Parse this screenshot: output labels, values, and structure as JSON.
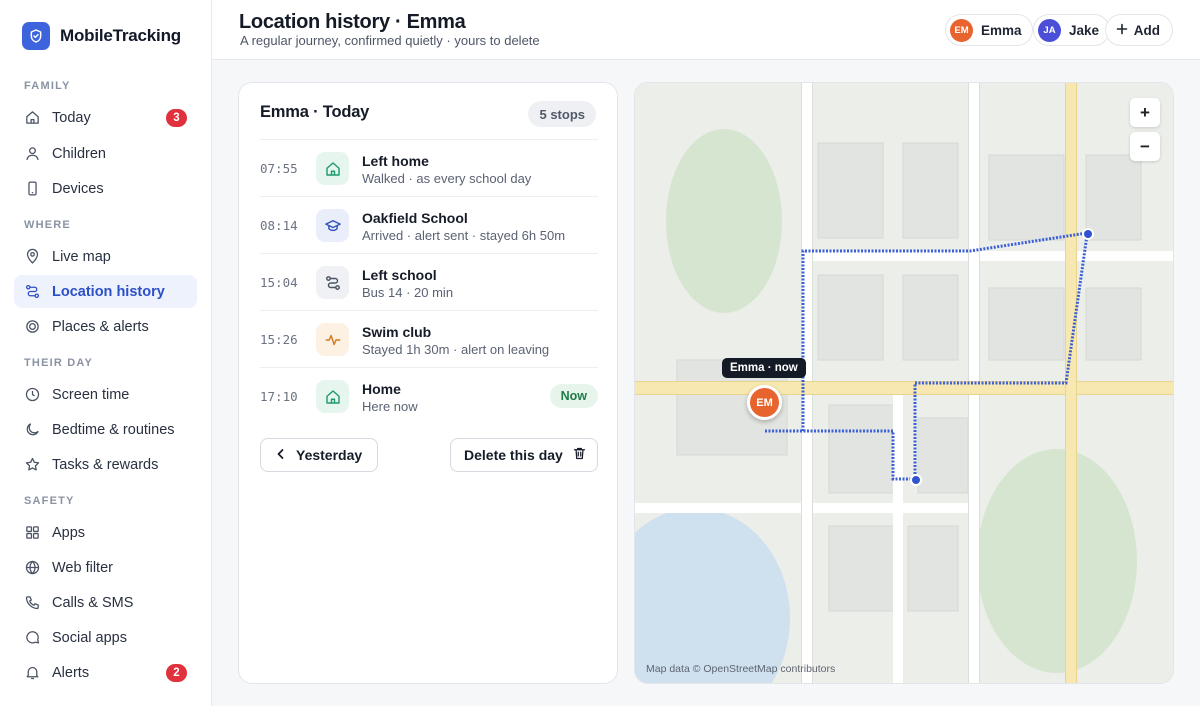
{
  "brand": {
    "name": "MobileTracking"
  },
  "nav": {
    "sections": [
      {
        "label": "FAMILY"
      },
      {
        "label": "WHERE"
      },
      {
        "label": "THEIR DAY"
      },
      {
        "label": "SAFETY"
      }
    ],
    "items": [
      {
        "label": "Today",
        "icon": "home-icon",
        "badge": "3"
      },
      {
        "label": "Children",
        "icon": "person-icon"
      },
      {
        "label": "Devices",
        "icon": "phone-icon"
      },
      {
        "label": "Live map",
        "icon": "pin-icon"
      },
      {
        "label": "Location history",
        "icon": "route-icon",
        "active": true
      },
      {
        "label": "Places & alerts",
        "icon": "target-icon"
      },
      {
        "label": "Screen time",
        "icon": "clock-icon"
      },
      {
        "label": "Bedtime & routines",
        "icon": "moon-icon"
      },
      {
        "label": "Tasks & rewards",
        "icon": "star-icon"
      },
      {
        "label": "Apps",
        "icon": "grid-icon"
      },
      {
        "label": "Web filter",
        "icon": "globe-icon"
      },
      {
        "label": "Calls & SMS",
        "icon": "phone-call-icon"
      },
      {
        "label": "Social apps",
        "icon": "chat-icon"
      },
      {
        "label": "Alerts",
        "icon": "bell-icon",
        "badge": "2"
      }
    ]
  },
  "header": {
    "title": "Location history · Emma",
    "subtitle": "A regular journey, confirmed quietly · yours to delete",
    "children": [
      {
        "initials": "EM",
        "name": "Emma",
        "color": "#e8642f"
      },
      {
        "initials": "JA",
        "name": "Jake",
        "color": "#4b4fd8"
      }
    ],
    "add_label": "Add"
  },
  "timeline": {
    "title": "Emma · Today",
    "stops_count": "5 stops",
    "stops": [
      {
        "time": "07:55",
        "title": "Left home",
        "detail": "Walked · as every school day",
        "icon": "home-icon",
        "tint": "#e7f5ef",
        "color": "#1f9a6e"
      },
      {
        "time": "08:14",
        "title": "Oakfield School",
        "detail": "Arrived · alert sent · stayed 6h 50m",
        "icon": "school-icon",
        "tint": "#eaeefb",
        "color": "#3552b8"
      },
      {
        "time": "15:04",
        "title": "Left school",
        "detail": "Bus 14 · 20 min",
        "icon": "route-icon",
        "tint": "#f0f1f4",
        "color": "#4a5264"
      },
      {
        "time": "15:26",
        "title": "Swim club",
        "detail": "Stayed 1h 30m · alert on leaving",
        "icon": "activity-icon",
        "tint": "#fdf1e3",
        "color": "#d37a1d"
      },
      {
        "time": "17:10",
        "title": "Home",
        "detail": "Here now",
        "icon": "home-icon",
        "tint": "#e7f5ef",
        "color": "#1f9a6e",
        "status": "Now"
      }
    ],
    "yesterday_label": "Yesterday",
    "delete_label": "Delete this day"
  },
  "map": {
    "zoom_in": "+",
    "zoom_out": "−",
    "marker_label": "Emma · now",
    "marker_initials": "EM",
    "credit": "Map data © OpenStreetMap contributors"
  },
  "colors": {
    "accent": "#3d63dd",
    "route": "#3b5fd6",
    "badge": "#e0313d"
  }
}
